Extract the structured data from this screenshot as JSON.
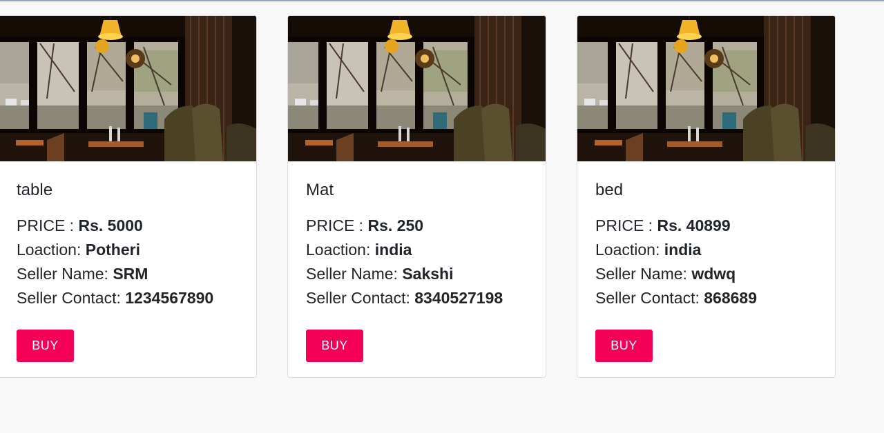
{
  "products": [
    {
      "name": "table",
      "price_label": "PRICE :",
      "price": "Rs. 5000",
      "location_label": "Loaction:",
      "location": "Potheri",
      "seller_label": "Seller Name:",
      "seller": "SRM",
      "contact_label": "Seller Contact:",
      "contact": "1234567890",
      "buy_label": "BUY"
    },
    {
      "name": "Mat",
      "price_label": "PRICE :",
      "price": "Rs. 250",
      "location_label": "Loaction:",
      "location": "india",
      "seller_label": "Seller Name:",
      "seller": "Sakshi",
      "contact_label": "Seller Contact:",
      "contact": "8340527198",
      "buy_label": "BUY"
    },
    {
      "name": "bed",
      "price_label": "PRICE :",
      "price": "Rs. 40899",
      "location_label": "Loaction:",
      "location": "india",
      "seller_label": "Seller Name:",
      "seller": "wdwq",
      "contact_label": "Seller Contact:",
      "contact": "868689",
      "buy_label": "BUY"
    }
  ],
  "colors": {
    "buy_button": "#f50057",
    "page_background": "#f8f8f8",
    "card_background": "#ffffff"
  }
}
